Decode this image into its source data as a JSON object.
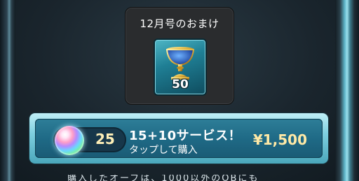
{
  "bonus": {
    "title": "12月号のおまけ",
    "item_icon": "chalice-icon",
    "item_count": "50"
  },
  "purchase": {
    "orb_icon": "orb-icon",
    "orb_count": "25",
    "offer_title": "15+10サービス！",
    "offer_subtitle": "タップして購入",
    "price": "¥1,500"
  },
  "footer": {
    "text": "購入したオーブは、1000以外のOBにも"
  },
  "colors": {
    "panel": "#2a2c2e",
    "button_face": "#1f6a86",
    "button_rim": "#7fd0e0",
    "price_text": "#ffe9a6"
  }
}
